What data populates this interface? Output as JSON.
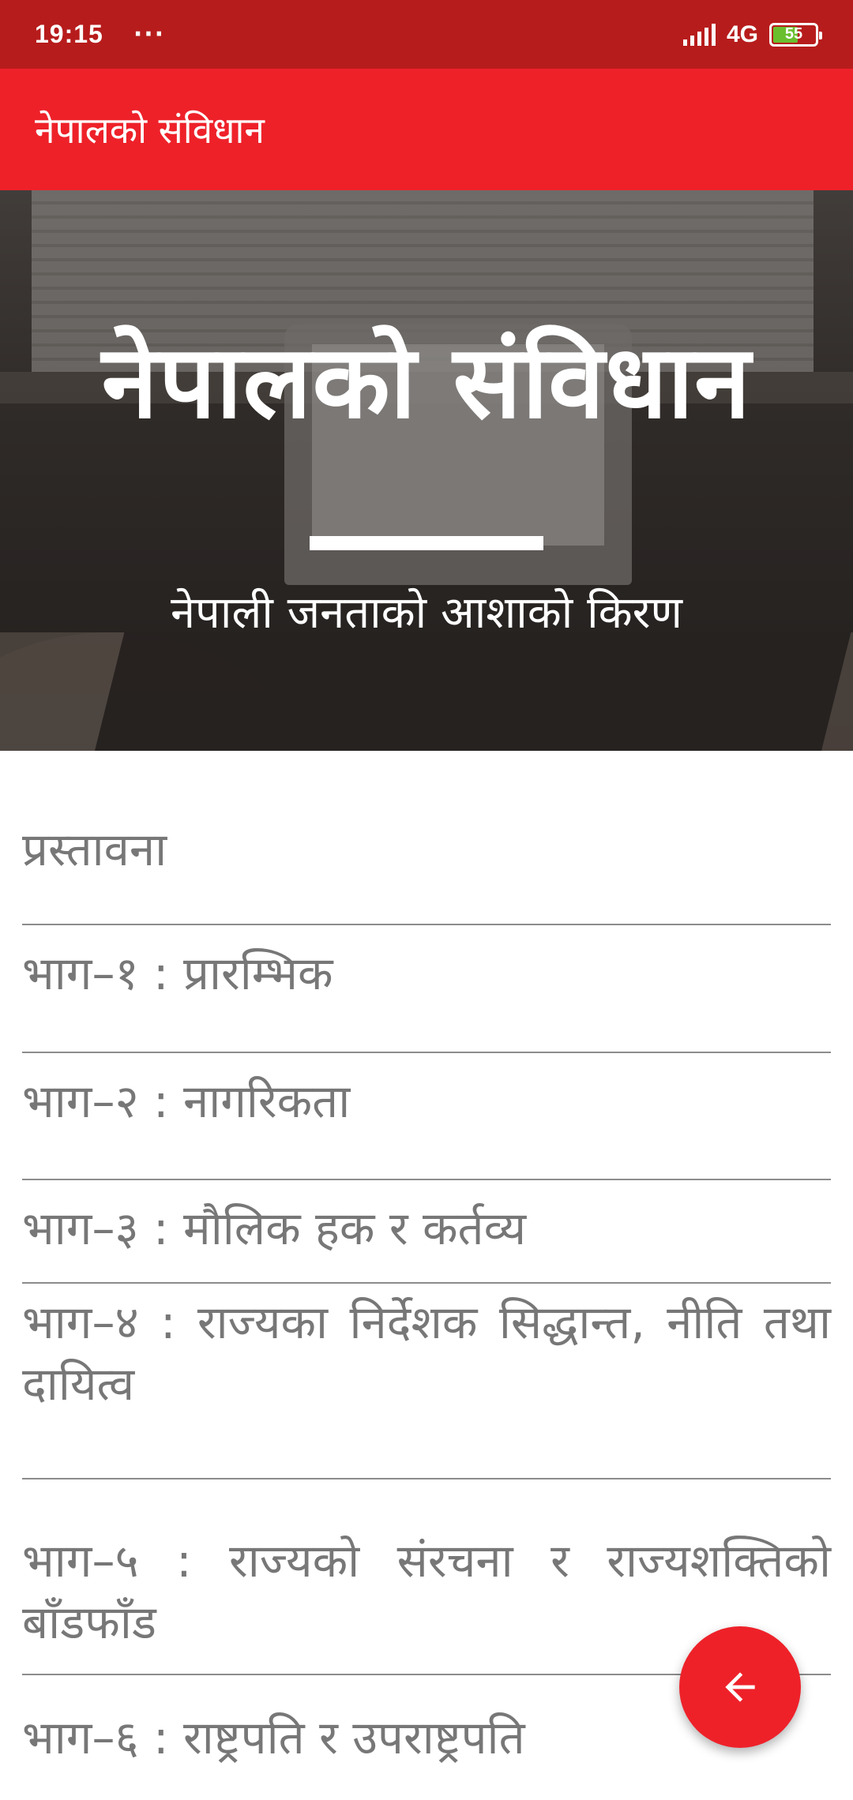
{
  "status_bar": {
    "time": "19:15",
    "dots": "···",
    "network": "4G",
    "battery": "55",
    "icons": [
      "signal-icon",
      "battery-icon"
    ]
  },
  "app_bar": {
    "title": "नेपालको संविधान",
    "color": "#ee2129"
  },
  "hero": {
    "title": "नेपालको संविधान",
    "subtitle": "नेपाली जनताको आशाको किरण"
  },
  "list": {
    "items": [
      {
        "label": "प्रस्तावना"
      },
      {
        "label": "भाग–१ : प्रारम्भिक"
      },
      {
        "label": "भाग–२ : नागरिकता"
      },
      {
        "label": "भाग–३ : मौलिक हक र कर्तव्य"
      },
      {
        "label": "भाग–४ : राज्यका निर्देशक सिद्धान्त, नीति तथा दायित्व"
      },
      {
        "label": "भाग–५ : राज्यको संरचना र राज्यशक्तिको बाँडफाँड"
      },
      {
        "label": "भाग–६ : राष्ट्रपति र उपराष्ट्रपति"
      }
    ]
  },
  "fab": {
    "icon": "arrow-back-icon",
    "color": "#ee2129"
  },
  "colors": {
    "status_bar": "#b71c1c",
    "accent": "#ee2129",
    "list_text": "#777777"
  }
}
